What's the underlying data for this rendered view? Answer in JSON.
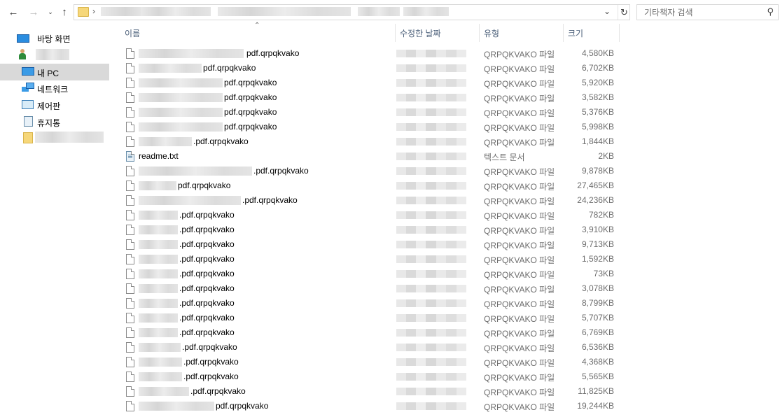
{
  "search": {
    "placeholder": "기타책자 검색"
  },
  "sidebar": {
    "items": [
      {
        "label": "바탕 화면",
        "icon": "desktop-icon"
      },
      {
        "label": "",
        "icon": "user-icon"
      },
      {
        "label": "내 PC",
        "icon": "pc-icon",
        "selected": true
      },
      {
        "label": "네트워크",
        "icon": "network-icon"
      },
      {
        "label": "제어판",
        "icon": "control-panel-icon"
      },
      {
        "label": "휴지통",
        "icon": "recycle-bin-icon"
      },
      {
        "label": "",
        "icon": "folder-icon"
      }
    ]
  },
  "columns": {
    "name": "이름",
    "date": "수정한 날짜",
    "type": "유형",
    "size": "크기"
  },
  "files": [
    {
      "name": "pdf.qrpqkvako",
      "type": "QRPQKVAKO 파일",
      "size": "4,580KB"
    },
    {
      "name": "pdf.qrpqkvako",
      "type": "QRPQKVAKO 파일",
      "size": "6,702KB"
    },
    {
      "name": "pdf.qrpqkvako",
      "type": "QRPQKVAKO 파일",
      "size": "5,920KB"
    },
    {
      "name": "pdf.qrpqkvako",
      "type": "QRPQKVAKO 파일",
      "size": "3,582KB"
    },
    {
      "name": "pdf.qrpqkvako",
      "type": "QRPQKVAKO 파일",
      "size": "5,376KB"
    },
    {
      "name": "pdf.qrpqkvako",
      "type": "QRPQKVAKO 파일",
      "size": "5,998KB"
    },
    {
      "name": ".pdf.qrpqkvako",
      "type": "QRPQKVAKO 파일",
      "size": "1,844KB"
    },
    {
      "name": "readme.txt",
      "type": "텍스트 문서",
      "size": "2KB",
      "icon": "text-file-icon"
    },
    {
      "name": ".pdf.qrpqkvako",
      "type": "QRPQKVAKO 파일",
      "size": "9,878KB"
    },
    {
      "name": "pdf.qrpqkvako",
      "type": "QRPQKVAKO 파일",
      "size": "27,465KB"
    },
    {
      "name": ".pdf.qrpqkvako",
      "type": "QRPQKVAKO 파일",
      "size": "24,236KB"
    },
    {
      "name": ".pdf.qrpqkvako",
      "type": "QRPQKVAKO 파일",
      "size": "782KB"
    },
    {
      "name": ".pdf.qrpqkvako",
      "type": "QRPQKVAKO 파일",
      "size": "3,910KB"
    },
    {
      "name": ".pdf.qrpqkvako",
      "type": "QRPQKVAKO 파일",
      "size": "9,713KB"
    },
    {
      "name": ".pdf.qrpqkvako",
      "type": "QRPQKVAKO 파일",
      "size": "1,592KB"
    },
    {
      "name": ".pdf.qrpqkvako",
      "type": "QRPQKVAKO 파일",
      "size": "73KB"
    },
    {
      "name": ".pdf.qrpqkvako",
      "type": "QRPQKVAKO 파일",
      "size": "3,078KB"
    },
    {
      "name": ".pdf.qrpqkvako",
      "type": "QRPQKVAKO 파일",
      "size": "8,799KB"
    },
    {
      "name": ".pdf.qrpqkvako",
      "type": "QRPQKVAKO 파일",
      "size": "5,707KB"
    },
    {
      "name": ".pdf.qrpqkvako",
      "type": "QRPQKVAKO 파일",
      "size": "6,769KB"
    },
    {
      "name": ".pdf.qrpqkvako",
      "type": "QRPQKVAKO 파일",
      "size": "6,536KB"
    },
    {
      "name": ".pdf.qrpqkvako",
      "type": "QRPQKVAKO 파일",
      "size": "4,368KB"
    },
    {
      "name": ".pdf.qrpqkvako",
      "type": "QRPQKVAKO 파일",
      "size": "5,565KB"
    },
    {
      "name": ".pdf.qrpqkvako",
      "type": "QRPQKVAKO 파일",
      "size": "11,825KB"
    },
    {
      "name": "pdf.qrpqkvako",
      "type": "QRPQKVAKO 파일",
      "size": "19,244KB"
    }
  ]
}
